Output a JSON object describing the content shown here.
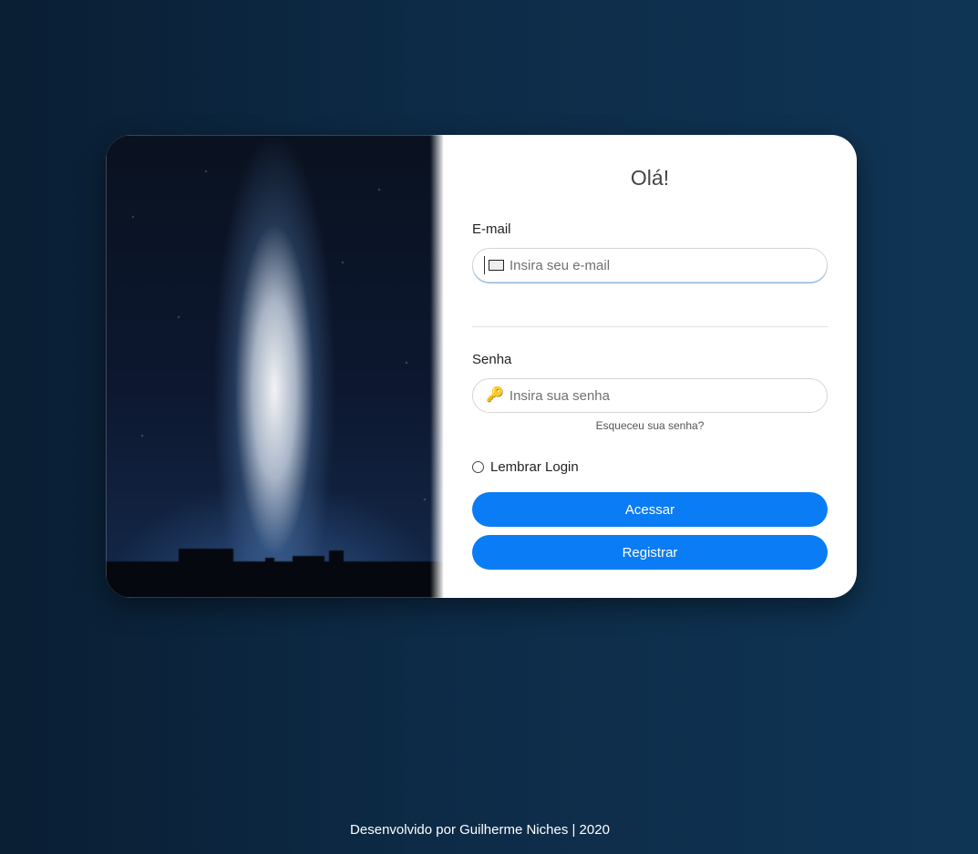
{
  "login": {
    "title": "Olá!",
    "email_label": "E-mail",
    "email_placeholder": "Insira seu e-mail",
    "password_label": "Senha",
    "password_placeholder": "Insira sua senha",
    "forgot_link": "Esqueceu sua senha?",
    "remember_label": "Lembrar Login",
    "login_button": "Acessar",
    "register_button": "Registrar"
  },
  "icons": {
    "email": "mail-icon",
    "password": "key-icon"
  },
  "colors": {
    "primary_button": "#0a7cf5",
    "background": "#0d2b47"
  },
  "footer": {
    "text": "Desenvolvido por Guilherme Niches | 2020"
  }
}
